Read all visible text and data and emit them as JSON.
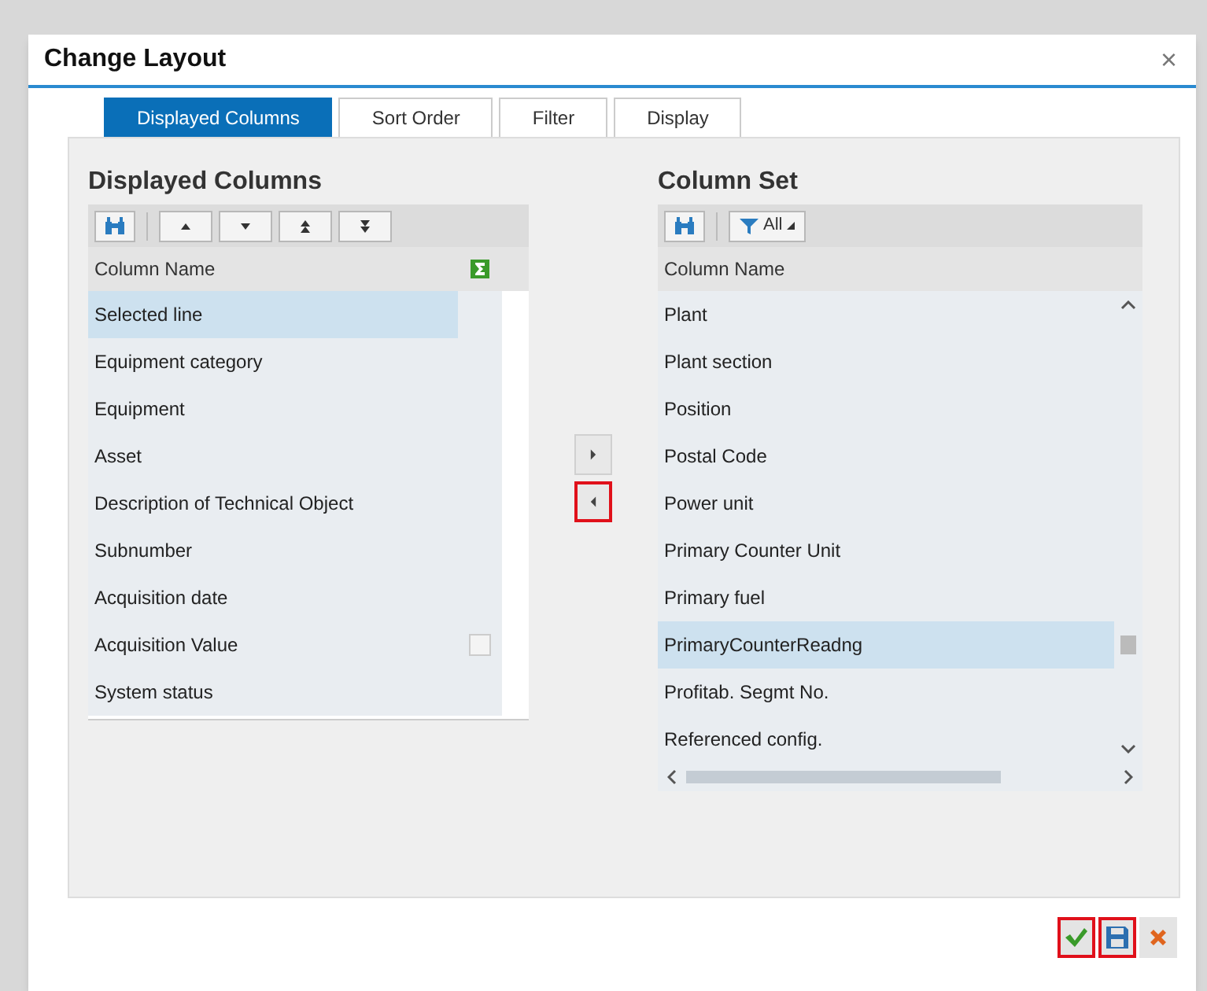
{
  "dialog": {
    "title": "Change Layout",
    "close": "×"
  },
  "tabs": [
    {
      "label": "Displayed Columns",
      "selected": true
    },
    {
      "label": "Sort Order",
      "selected": false
    },
    {
      "label": "Filter",
      "selected": false
    },
    {
      "label": "Display",
      "selected": false
    }
  ],
  "displayed_columns": {
    "title": "Displayed Columns",
    "header": "Column Name",
    "rows": [
      {
        "name": "Selected line",
        "selected": true
      },
      {
        "name": "Equipment category",
        "selected": false
      },
      {
        "name": "Equipment",
        "selected": false
      },
      {
        "name": "Asset",
        "selected": false
      },
      {
        "name": "Description of Technical Object",
        "selected": false
      },
      {
        "name": "Subnumber",
        "selected": false
      },
      {
        "name": "Acquisition date",
        "selected": false
      },
      {
        "name": "Acquisition Value",
        "selected": false,
        "sum_checkbox": {
          "checked": false
        }
      },
      {
        "name": "System status",
        "selected": false
      }
    ]
  },
  "move_buttons": [
    {
      "kind": "right",
      "highlighted": false
    },
    {
      "kind": "left",
      "highlighted": true
    }
  ],
  "column_set": {
    "title": "Column Set",
    "filter_label": "All",
    "header": "Column Name",
    "rows": [
      {
        "name": "Plant",
        "selected": false
      },
      {
        "name": "Plant section",
        "selected": false
      },
      {
        "name": "Position",
        "selected": false
      },
      {
        "name": "Postal Code",
        "selected": false
      },
      {
        "name": "Power unit",
        "selected": false
      },
      {
        "name": "Primary Counter Unit",
        "selected": false
      },
      {
        "name": "Primary fuel",
        "selected": false
      },
      {
        "name": "PrimaryCounterReadng",
        "selected": true
      },
      {
        "name": "Profitab. Segmt No.",
        "selected": false
      },
      {
        "name": "Referenced config.",
        "selected": false
      }
    ]
  },
  "footer_buttons": [
    {
      "kind": "confirm",
      "highlighted": true
    },
    {
      "kind": "save",
      "highlighted": true
    },
    {
      "kind": "cancel",
      "highlighted": false
    }
  ]
}
